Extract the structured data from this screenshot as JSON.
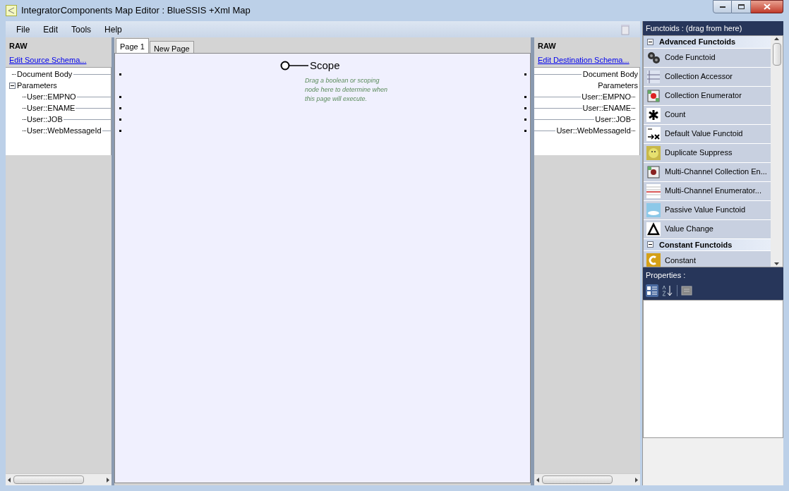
{
  "window": {
    "title": "IntegratorComponents Map Editor : BlueSSIS +Xml Map"
  },
  "menu": [
    "File",
    "Edit",
    "Tools",
    "Help"
  ],
  "source": {
    "heading": "RAW",
    "link": "Edit Source Schema...",
    "tree": [
      {
        "label": "Document Body"
      },
      {
        "label": "Parameters",
        "expanded": true,
        "children": [
          {
            "label": "User::EMPNO"
          },
          {
            "label": "User::ENAME"
          },
          {
            "label": "User::JOB"
          },
          {
            "label": "User::WebMessageId"
          }
        ]
      }
    ]
  },
  "tabs": [
    {
      "label": "Page 1",
      "selected": true
    },
    {
      "label": "New Page",
      "selected": false
    }
  ],
  "scope": {
    "label": "Scope",
    "hint": "Drag a boolean or scoping node here to determine when this page will execute."
  },
  "destination": {
    "heading": "RAW",
    "link": "Edit Destination Schema...",
    "tree": [
      {
        "label": "Document Body"
      },
      {
        "label": "Parameters",
        "children": [
          {
            "label": "User::EMPNO"
          },
          {
            "label": "User::ENAME"
          },
          {
            "label": "User::JOB"
          },
          {
            "label": "User::WebMessageId"
          }
        ]
      }
    ]
  },
  "functoids": {
    "title": "Functoids : (drag from here)",
    "sections": [
      {
        "label": "Advanced Functoids",
        "expanded": true,
        "items": [
          "Code Functoid",
          "Collection Accessor",
          "Collection Enumerator",
          "Count",
          "Default Value Functoid",
          "Duplicate Suppress",
          "Multi-Channel Collection En...",
          "Multi-Channel Enumerator...",
          "Passive Value Functoid",
          "Value Change"
        ]
      },
      {
        "label": "Constant Functoids",
        "expanded": true,
        "items": [
          "Constant"
        ]
      }
    ]
  },
  "properties": {
    "title": "Properties :"
  }
}
